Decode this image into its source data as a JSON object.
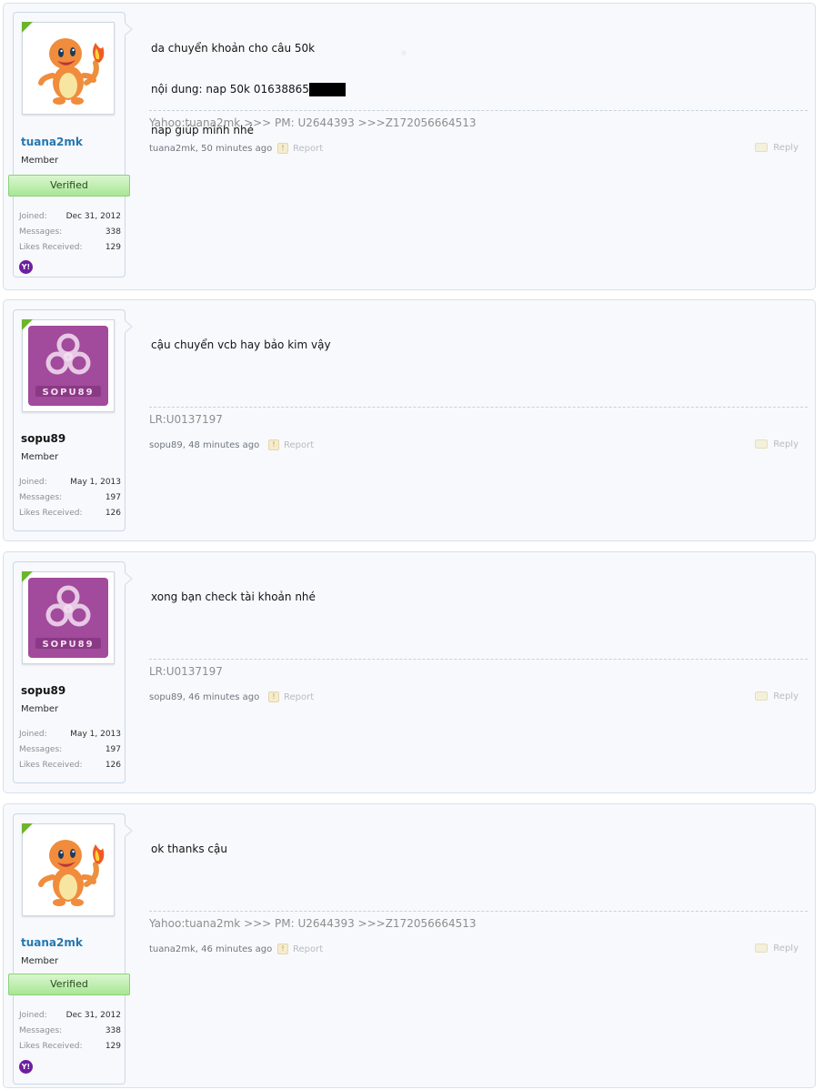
{
  "posts": [
    {
      "username": "tuana2mk",
      "user_title": "Member",
      "verified_label": "Verified",
      "avatar": "charmander-avatar",
      "stats": {
        "joined_label": "Joined:",
        "joined": "Dec 31, 2012",
        "messages_label": "Messages:",
        "messages": "338",
        "likes_label": "Likes Received:",
        "likes": "129"
      },
      "contact_icon": "yahoo-icon",
      "message_lines": [
        "da chuyển khoản cho câu 50k",
        "nội dung: nap 50k 01638865",
        "nap giúp mình nhé"
      ],
      "signature": "Yahoo:tuana2mk >>> PM: U2644393 >>>Z172056664513",
      "meta": "tuana2mk, 50 minutes ago",
      "report_label": "Report",
      "reply_label": "Reply"
    },
    {
      "username": "sopu89",
      "user_title": "Member",
      "avatar": "sopu89-biohazard-avatar",
      "avatar_text": "SOPU89",
      "stats": {
        "joined_label": "Joined:",
        "joined": "May 1, 2013",
        "messages_label": "Messages:",
        "messages": "197",
        "likes_label": "Likes Received:",
        "likes": "126"
      },
      "message_lines": [
        "cậu chuyển vcb hay bảo kim vậy"
      ],
      "signature": "LR:U0137197",
      "meta": "sopu89, 48 minutes ago",
      "report_label": "Report",
      "reply_label": "Reply"
    },
    {
      "username": "sopu89",
      "user_title": "Member",
      "avatar": "sopu89-biohazard-avatar",
      "avatar_text": "SOPU89",
      "stats": {
        "joined_label": "Joined:",
        "joined": "May 1, 2013",
        "messages_label": "Messages:",
        "messages": "197",
        "likes_label": "Likes Received:",
        "likes": "126"
      },
      "message_lines": [
        "xong bạn check tài khoản nhé"
      ],
      "signature": "LR:U0137197",
      "meta": "sopu89, 46 minutes ago",
      "report_label": "Report",
      "reply_label": "Reply"
    },
    {
      "username": "tuana2mk",
      "user_title": "Member",
      "verified_label": "Verified",
      "avatar": "charmander-avatar",
      "stats": {
        "joined_label": "Joined:",
        "joined": "Dec 31, 2012",
        "messages_label": "Messages:",
        "messages": "338",
        "likes_label": "Likes Received:",
        "likes": "129"
      },
      "contact_icon": "yahoo-icon",
      "message_lines": [
        "ok thanks cậu"
      ],
      "signature": "Yahoo:tuana2mk >>> PM: U2644393 >>>Z172056664513",
      "meta": "tuana2mk, 46 minutes ago",
      "report_label": "Report",
      "reply_label": "Reply"
    }
  ],
  "colors": {
    "username_link": "#2577b1",
    "verified_green": "#a8e694",
    "online_flag": "#6cb52d",
    "sopu_purple": "#a24a9b",
    "yahoo_purple": "#6d1fa0"
  }
}
